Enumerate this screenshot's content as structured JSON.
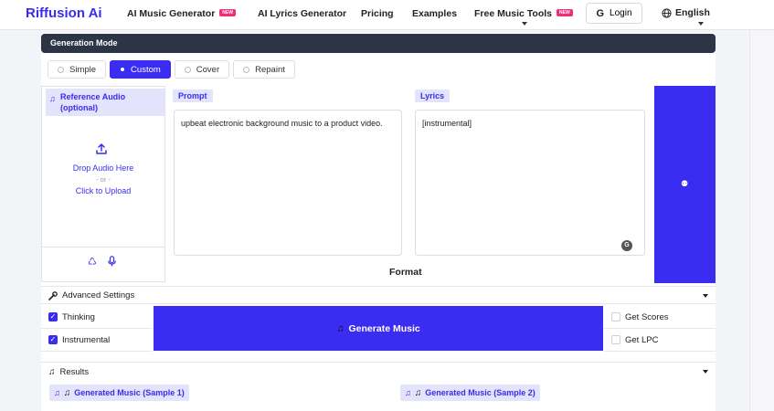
{
  "nav": {
    "brand": "Riffusion Ai",
    "items": [
      {
        "label": "AI Music Generator",
        "badge": "NEW"
      },
      {
        "label": "AI Lyrics Generator"
      },
      {
        "label": "Pricing"
      },
      {
        "label": "Examples"
      },
      {
        "label": "Free Music Tools",
        "badge": "NEW"
      }
    ],
    "login_label": "Login",
    "language": "English"
  },
  "generation": {
    "header": "Generation Mode",
    "modes": [
      {
        "label": "Simple",
        "active": false
      },
      {
        "label": "Custom",
        "active": true
      },
      {
        "label": "Cover",
        "active": false
      },
      {
        "label": "Repaint",
        "active": false
      }
    ]
  },
  "reference_audio": {
    "label": "Reference Audio (optional)",
    "drop_text": "Drop Audio Here",
    "or_text": "- or -",
    "upload_text": "Click to Upload"
  },
  "prompt": {
    "label": "Prompt",
    "value": "upbeat electronic background music to a product video."
  },
  "lyrics": {
    "label": "Lyrics",
    "value": "[instrumental]"
  },
  "format_label": "Format",
  "advanced": {
    "label": "Advanced Settings",
    "options_left": [
      {
        "label": "Thinking",
        "checked": true
      },
      {
        "label": "Instrumental",
        "checked": true
      }
    ],
    "options_right": [
      {
        "label": "Get Scores",
        "checked": false
      },
      {
        "label": "Get LPC",
        "checked": false
      }
    ]
  },
  "generate_button": "Generate Music",
  "results": {
    "label": "Results",
    "samples": [
      "Generated Music (Sample 1)",
      "Generated Music (Sample 2)"
    ]
  },
  "colors": {
    "accent": "#3a2cf0",
    "header_dark": "#2c3445",
    "badge": "#ec2f77",
    "label_bg": "#e3e3fb"
  }
}
